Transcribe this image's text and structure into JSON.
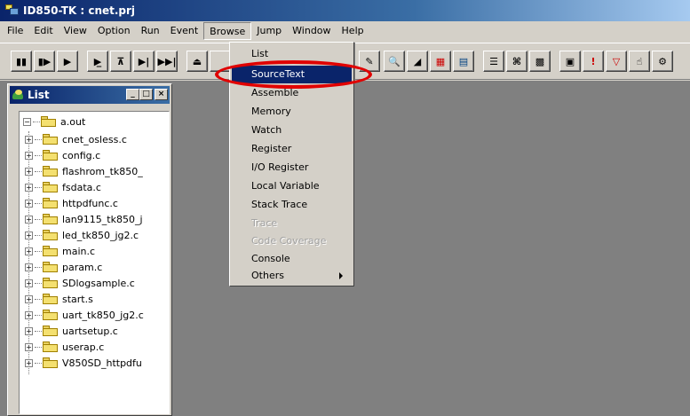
{
  "window": {
    "title": "ID850-TK : cnet.prj"
  },
  "menubar": {
    "items": [
      "File",
      "Edit",
      "View",
      "Option",
      "Run",
      "Event",
      "Browse",
      "Jump",
      "Window",
      "Help"
    ]
  },
  "list_panel": {
    "title": "List",
    "root": "a.out",
    "files": [
      "cnet_osless.c",
      "config.c",
      "flashrom_tk850_",
      "fsdata.c",
      "httpdfunc.c",
      "lan9115_tk850_j",
      "led_tk850_jg2.c",
      "main.c",
      "param.c",
      "SDlogsample.c",
      "start.s",
      "uart_tk850_jg2.c",
      "uartsetup.c",
      "userap.c",
      "V850SD_httpdfu"
    ]
  },
  "browse_menu": {
    "items": [
      {
        "label": "List",
        "state": "normal"
      },
      {
        "label": "SourceText",
        "state": "highlighted"
      },
      {
        "label": "Assemble",
        "state": "normal"
      },
      {
        "label": "Memory",
        "state": "normal"
      },
      {
        "label": "Watch",
        "state": "normal"
      },
      {
        "label": "Register",
        "state": "normal"
      },
      {
        "label": "I/O Register",
        "state": "normal"
      },
      {
        "label": "Local Variable",
        "state": "normal"
      },
      {
        "label": "Stack Trace",
        "state": "normal"
      },
      {
        "label": "Trace",
        "state": "disabled"
      },
      {
        "label": "Code Coverage",
        "state": "disabled"
      },
      {
        "label": "Console",
        "state": "normal"
      },
      {
        "label": "Others",
        "state": "submenu"
      }
    ]
  },
  "colors": {
    "title_bar": "#0a246a",
    "menu_highlight": "#0a246a",
    "annotation_ring": "#e00000"
  }
}
